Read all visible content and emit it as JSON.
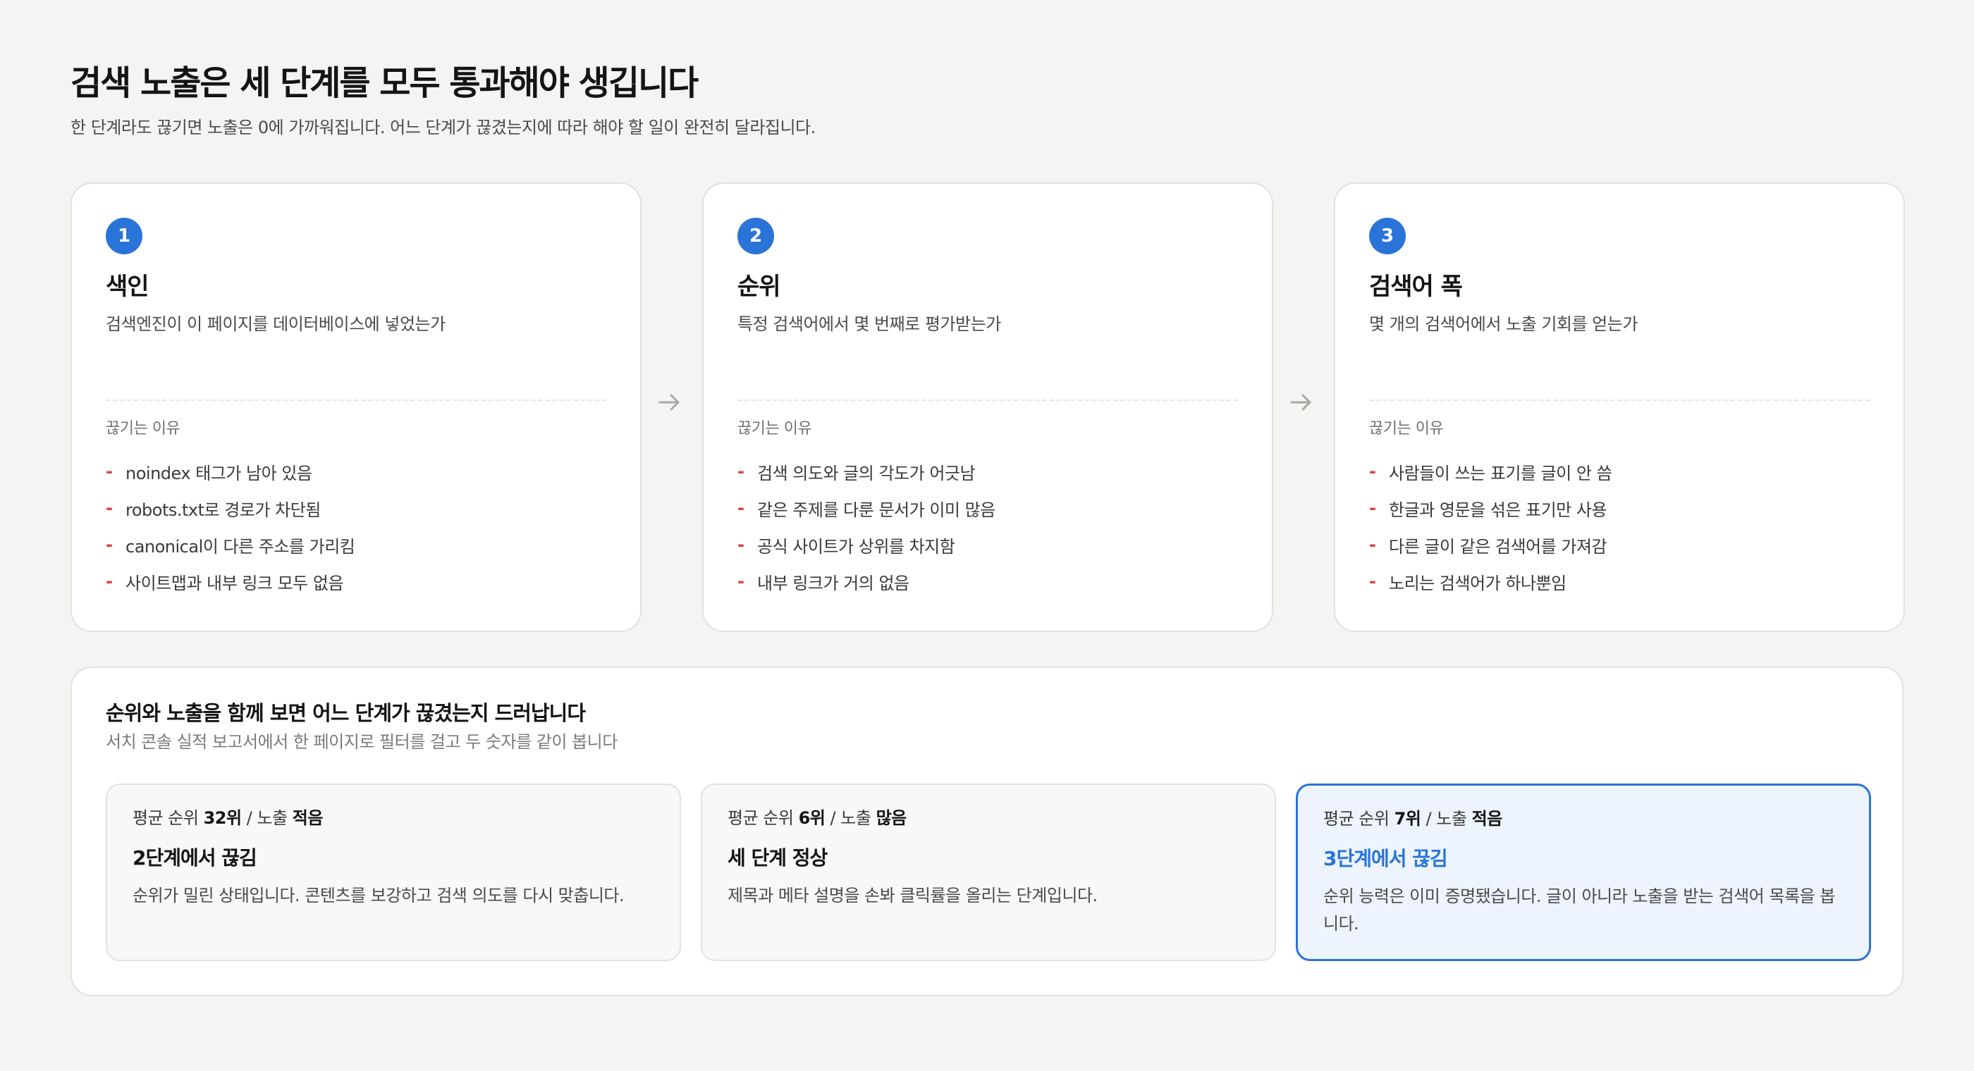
{
  "header": {
    "title": "검색 노출은 세 단계를 모두 통과해야 생깁니다",
    "subtitle": "한 단계라도 끊기면 노출은 0에 가까워집니다. 어느 단계가 끊겼는지에 따라 해야 할 일이 완전히 달라집니다."
  },
  "stages": [
    {
      "number": "1",
      "name": "색인",
      "description": "검색엔진이 이 페이지를 데이터베이스에 넣었는가",
      "reasons_label": "끊기는 이유",
      "reasons": [
        "noindex 태그가 남아 있음",
        "robots.txt로 경로가 차단됨",
        "canonical이 다른 주소를 가리킴",
        "사이트맵과 내부 링크 모두 없음"
      ]
    },
    {
      "number": "2",
      "name": "순위",
      "description": "특정 검색어에서 몇 번째로 평가받는가",
      "reasons_label": "끊기는 이유",
      "reasons": [
        "검색 의도와 글의 각도가 어긋남",
        "같은 주제를 다룬 문서가 이미 많음",
        "공식 사이트가 상위를 차지함",
        "내부 링크가 거의 없음"
      ]
    },
    {
      "number": "3",
      "name": "검색어 폭",
      "description": "몇 개의 검색어에서 노출 기회를 얻는가",
      "reasons_label": "끊기는 이유",
      "reasons": [
        "사람들이 쓰는 표기를 글이 안 씀",
        "한글과 영문을 섞은 표기만 사용",
        "다른 글이 같은 검색어를 가져감",
        "노리는 검색어가 하나뿐임"
      ]
    }
  ],
  "diagnosis": {
    "title": "순위와 노출을 함께 보면 어느 단계가 끊겼는지 드러납니다",
    "subtitle": "서치 콘솔 실적 보고서에서 한 페이지로 필터를 걸고 두 숫자를 같이 봅니다",
    "cases": [
      {
        "rank_label": "평균 순위",
        "rank_value": "32위",
        "sep": "/",
        "exposure_label": "노출",
        "exposure_value": "적음",
        "verdict": "2단계에서 끊김",
        "description": "순위가 밀린 상태입니다. 콘텐츠를 보강하고 검색 의도를 다시 맞춥니다."
      },
      {
        "rank_label": "평균 순위",
        "rank_value": "6위",
        "sep": "/",
        "exposure_label": "노출",
        "exposure_value": "많음",
        "verdict": "세 단계 정상",
        "description": "제목과 메타 설명을 손봐 클릭률을 올리는 단계입니다."
      },
      {
        "rank_label": "평균 순위",
        "rank_value": "7위",
        "sep": "/",
        "exposure_label": "노출",
        "exposure_value": "적음",
        "verdict": "3단계에서 끊김",
        "description": "순위 능력은 이미 증명됐습니다. 글이 아니라 노출을 받는 검색어 목록을 봅니다."
      }
    ]
  },
  "colors": {
    "accent": "#2a73d8",
    "dash": "#e0403a",
    "background": "#f4f4f2",
    "highlight_bg": "#edf4fe"
  },
  "icons": {
    "flow_arrow": "arrow-right-icon"
  }
}
